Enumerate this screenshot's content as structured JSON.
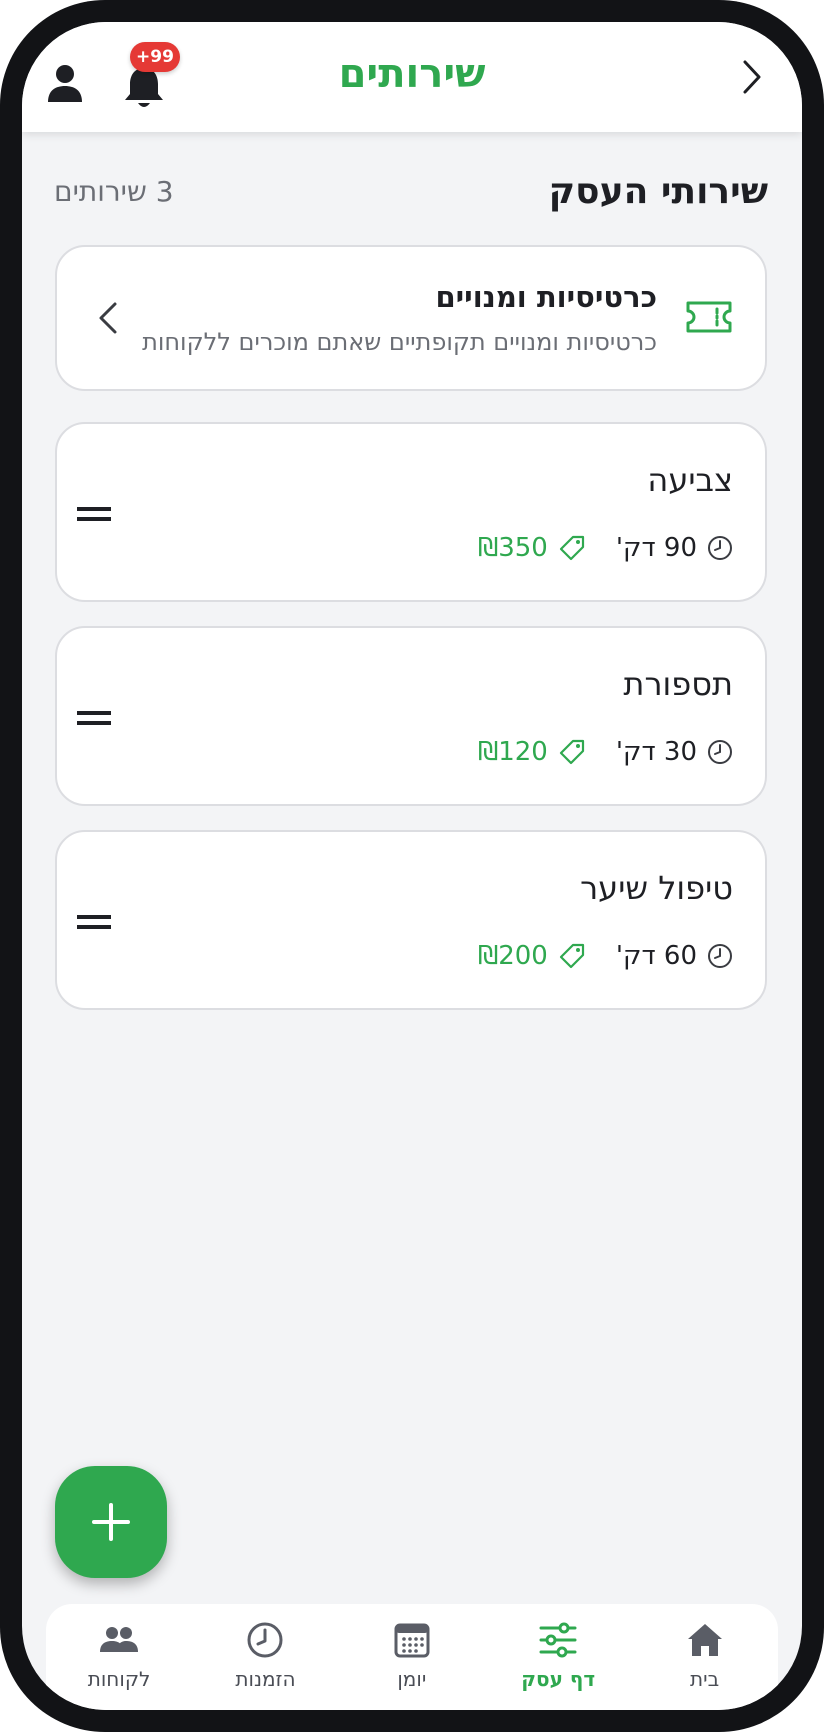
{
  "header": {
    "title": "שירותים",
    "notification_badge": "+99"
  },
  "section": {
    "title": "שירותי העסק",
    "count": "3 שירותים"
  },
  "packages_card": {
    "title": "כרטיסיות ומנויים",
    "subtitle": "כרטיסיות ומנויים תקופתיים שאתם מוכרים ללקוחות",
    "icon": "ticket-icon"
  },
  "services": [
    {
      "name": "צביעה",
      "duration": "90 דק'",
      "price": "₪350"
    },
    {
      "name": "תספורת",
      "duration": "30 דק'",
      "price": "₪120"
    },
    {
      "name": "טיפול שיער",
      "duration": "60 דק'",
      "price": "₪200"
    }
  ],
  "bottom_nav": {
    "items": [
      {
        "label": "בית",
        "icon": "home-icon"
      },
      {
        "label": "דף עסק",
        "icon": "sliders-icon",
        "active": true
      },
      {
        "label": "יומן",
        "icon": "calendar-icon"
      },
      {
        "label": "הזמנות",
        "icon": "clock-icon"
      },
      {
        "label": "לקוחות",
        "icon": "customers-icon"
      }
    ]
  },
  "colors": {
    "accent": "#2fa84f",
    "badge": "#e53935",
    "text": "#1e1f24",
    "muted_text": "#6b6e75",
    "background": "#f3f4f6",
    "frame": "#121316"
  }
}
